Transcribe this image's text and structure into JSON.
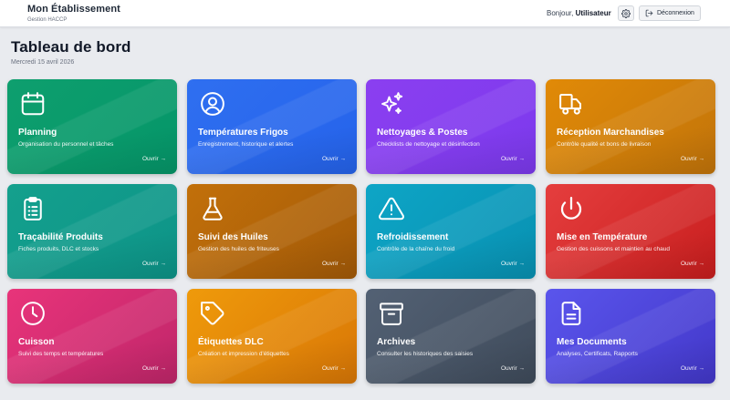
{
  "header": {
    "brand_title": "Mon Établissement",
    "brand_subtitle": "Gestion HACCP",
    "greeting_prefix": "Bonjour,",
    "user_name": "Utilisateur",
    "settings_icon": "gear-icon",
    "logout_icon": "logout-icon",
    "logout_label": "Déconnexion"
  },
  "page": {
    "title": "Tableau de bord",
    "date": "Mercredi 15 avril 2026"
  },
  "cards": [
    {
      "title": "Planning",
      "desc": "Organisation du personnel et tâches",
      "open": "Ouvrir →",
      "icon": "calendar-icon",
      "colors": [
        "#0e9f6e",
        "#059669"
      ]
    },
    {
      "title": "Températures Frigos",
      "desc": "Enregistrement, historique et alertes",
      "open": "Ouvrir →",
      "icon": "user-circle-icon",
      "colors": [
        "#2f6ff0",
        "#2563eb"
      ]
    },
    {
      "title": "Nettoyages & Postes",
      "desc": "Checklists de nettoyage et désinfection",
      "open": "Ouvrir →",
      "icon": "sparkles-icon",
      "colors": [
        "#8b3ff0",
        "#7c3aed"
      ]
    },
    {
      "title": "Réception Marchandises",
      "desc": "Contrôle qualité et bons de livraison",
      "open": "Ouvrir →",
      "icon": "truck-icon",
      "colors": [
        "#e18a07",
        "#c2740a"
      ]
    },
    {
      "title": "Traçabilité Produits",
      "desc": "Fiches produits, DLC et stocks",
      "open": "Ouvrir →",
      "icon": "clipboard-list-icon",
      "colors": [
        "#14a08d",
        "#0d9488"
      ]
    },
    {
      "title": "Suivi des Huiles",
      "desc": "Gestion des huiles de friteuses",
      "open": "Ouvrir →",
      "icon": "flask-icon",
      "colors": [
        "#c2700a",
        "#a35a08"
      ]
    },
    {
      "title": "Refroidissement",
      "desc": "Contrôle de la chaîne du froid",
      "open": "Ouvrir →",
      "icon": "warning-triangle-icon",
      "colors": [
        "#0ea5c6",
        "#0891b2"
      ]
    },
    {
      "title": "Mise en Température",
      "desc": "Gestion des cuissons et maintien au chaud",
      "open": "Ouvrir →",
      "icon": "power-icon",
      "colors": [
        "#e53e3e",
        "#c81e1e"
      ]
    },
    {
      "title": "Cuisson",
      "desc": "Suivi des temps et températures",
      "open": "Ouvrir →",
      "icon": "clock-icon",
      "colors": [
        "#e8347a",
        "#c0266a"
      ]
    },
    {
      "title": "Étiquettes DLC",
      "desc": "Création et impression d'étiquettes",
      "open": "Ouvrir →",
      "icon": "tag-icon",
      "colors": [
        "#ef9a0b",
        "#d97706"
      ]
    },
    {
      "title": "Archives",
      "desc": "Consulter les historiques des saisies",
      "open": "Ouvrir →",
      "icon": "archive-box-icon",
      "colors": [
        "#536174",
        "#3f4b5b"
      ]
    },
    {
      "title": "Mes Documents",
      "desc": "Analyses, Certificats, Rapports",
      "open": "Ouvrir →",
      "icon": "document-icon",
      "colors": [
        "#5a55ec",
        "#4338ca"
      ]
    }
  ]
}
